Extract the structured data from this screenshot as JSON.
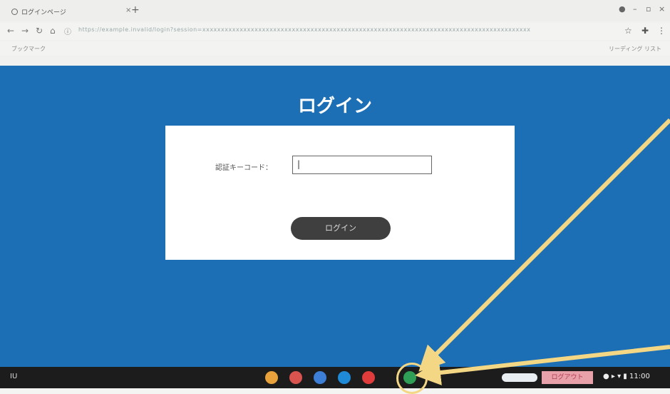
{
  "browser": {
    "tab_title": "ログインページ",
    "url": "https://example.invalid/login?session=xxxxxxxxxxxxxxxxxxxxxxxxxxxxxxxxxxxxxxxxxxxxxxxxxxxxxxxxxxxxxxxxxxxxxxxxxxxxxxxxxxxxxxxx",
    "bookmarks_item": "ブックマーク",
    "reading_list": "リーディング リスト"
  },
  "page": {
    "title": "ログイン",
    "card": {
      "field_label": "認証キーコード：",
      "field_value": "|",
      "button_label": "ログイン"
    }
  },
  "shelf": {
    "launcher_label": "IU",
    "apps": [
      {
        "name": "chrome-icon",
        "color": "#e9a23b"
      },
      {
        "name": "gmail-icon",
        "color": "#d9534f"
      },
      {
        "name": "docs-icon",
        "color": "#3d7fd6"
      },
      {
        "name": "files-icon",
        "color": "#1f8ad7"
      },
      {
        "name": "youtube-icon",
        "color": "#e03c3c"
      },
      {
        "name": "classroom-icon",
        "color": "#2f9e57"
      }
    ],
    "logout_label": "ログアウト",
    "status_time": "11:00"
  },
  "colors": {
    "page_bg": "#1d6fb5",
    "button_bg": "#3f3f3f",
    "annotation": "#f4d784"
  }
}
